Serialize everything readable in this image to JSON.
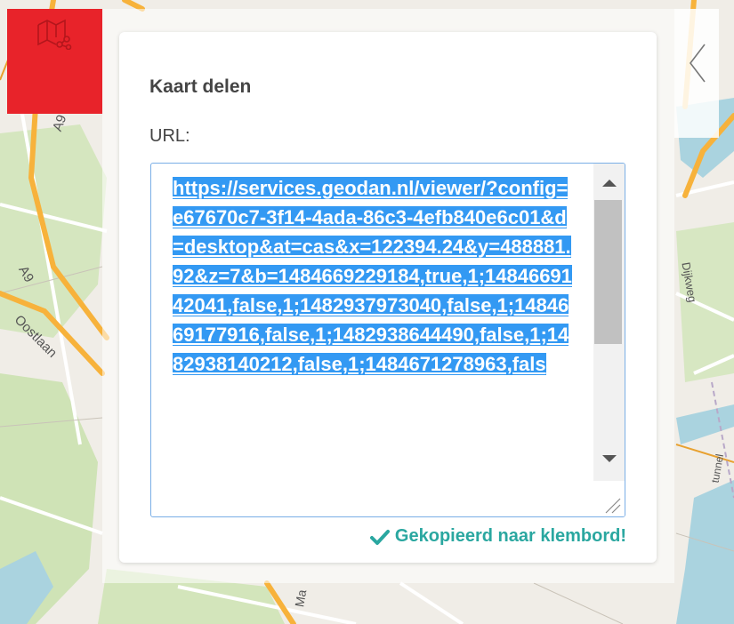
{
  "map": {
    "labels": {
      "a9_top": "A9",
      "a9_left": "A9",
      "oostlaan": "Oostlaan",
      "dijkweg": "Dijkweg",
      "ma": "Ma",
      "tunnel": "tunnel"
    },
    "colors": {
      "background": "#f0ede7",
      "green": "#cfe3b6",
      "water": "#aad3df",
      "motorway": "#f7b23b",
      "road": "#ffffff"
    }
  },
  "toolbar": {
    "share_tool_icon": "map-share-icon",
    "accent_color": "#e8232a",
    "collapse_icon": "chevron-left-icon"
  },
  "share_panel": {
    "title": "Kaart delen",
    "url_label": "URL:",
    "url_value": "https://services.geodan.nl/viewer/?config=e67670c7-3f14-4ada-86c3-4efb840e6c01&d=desktop&at=cas&x=122394.24&y=488881.92&z=7&b=1484669229184,true,1;1484669142041,false,1;1482937973040,false,1;1484669177916,false,1;1482938644490,false,1;1482938140212,false,1;1484671278963,fals",
    "status_message": "Gekopieerd naar klembord!",
    "status_icon": "checkmark-icon",
    "status_color": "#2aa7a0",
    "selection_color": "#3399f3"
  }
}
